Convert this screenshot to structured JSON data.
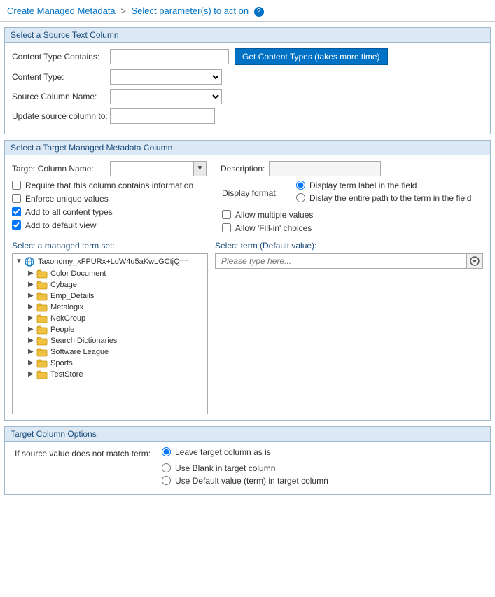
{
  "breadcrumb": {
    "part1": "Create Managed Metadata",
    "separator": ">",
    "part2": "Select parameter(s) to act on"
  },
  "section1": {
    "title": "Select a Source Text Column",
    "content_type_contains_label": "Content Type Contains:",
    "content_type_contains_value": "",
    "btn_get_content_types": "Get Content Types (takes more time)",
    "content_type_label": "Content Type:",
    "content_type_value": "",
    "source_column_label": "Source Column Name:",
    "source_column_value": "",
    "update_source_label": "Update source column to:",
    "update_source_value": ""
  },
  "section2": {
    "title": "Select a Target Managed Metadata Column",
    "target_column_label": "Target Column Name:",
    "target_column_value": "",
    "description_label": "Description:",
    "description_value": "",
    "checkbox_require": "Require that this column contains information",
    "checkbox_require_checked": false,
    "checkbox_enforce": "Enforce unique values",
    "checkbox_enforce_checked": false,
    "checkbox_add_content": "Add to all content types",
    "checkbox_add_content_checked": true,
    "checkbox_default_view": "Add to default view",
    "checkbox_default_view_checked": true,
    "display_format_label": "Display format:",
    "radio_display_label": "Display term label in the field",
    "radio_display_path": "Dislay the entire path to the term in the field",
    "radio_display_checked": "label",
    "allow_multiple_label": "Allow multiple values",
    "allow_multiple_checked": false,
    "allow_fillin_label": "Allow 'Fill-in' choices",
    "allow_fillin_checked": false,
    "term_set_section_label": "Select a managed term set:",
    "term_set_root": "Taxonomy_xFPURx+LdW4u5aKwLGCtjQ==",
    "term_set_items": [
      "Color Document",
      "Cybage",
      "Emp_Details",
      "Metalogix",
      "NekGroup",
      "People",
      "Search Dictionaries",
      "Software League",
      "Sports",
      "TestStore"
    ],
    "select_term_label": "Select term (Default value):",
    "select_term_placeholder": "Please type here..."
  },
  "section3": {
    "title": "Target Column Options",
    "if_no_match_label": "If source value does not match term:",
    "radio_leave": "Leave target column as is",
    "radio_blank": "Use Blank in target column",
    "radio_default": "Use Default value (term) in target column",
    "radio_leave_checked": true
  },
  "icons": {
    "help": "?",
    "dropdown_arrow": "▼",
    "folder": "📁",
    "taxonomy": "🌐",
    "browse": "◎"
  }
}
